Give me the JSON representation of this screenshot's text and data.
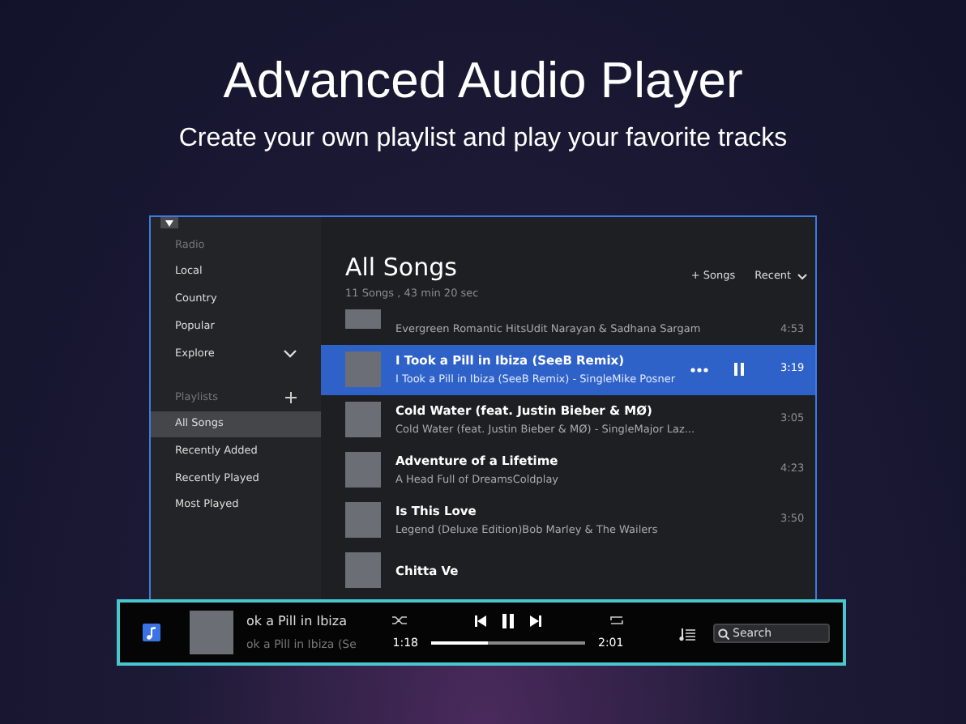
{
  "headline": "Advanced Audio Player",
  "subheadline": "Create your own playlist and play your favorite tracks",
  "sidebar": {
    "sections": [
      {
        "heading": "Radio",
        "items": [
          {
            "label": "Local",
            "selected": false
          },
          {
            "label": "Country",
            "selected": false
          },
          {
            "label": "Popular",
            "selected": false
          },
          {
            "label": "Explore",
            "selected": false,
            "expandable": true
          }
        ]
      },
      {
        "heading": "Playlists",
        "add_button": true,
        "items": [
          {
            "label": "All Songs",
            "selected": true
          },
          {
            "label": "Recently Added",
            "selected": false
          },
          {
            "label": "Recently Played",
            "selected": false
          },
          {
            "label": "Most Played",
            "selected": false
          }
        ]
      }
    ]
  },
  "content": {
    "title": "All Songs",
    "summary": "11 Songs , 43 min 20 sec",
    "add_songs": "+ Songs",
    "sort": "Recent",
    "songs": [
      {
        "subtitle": "Evergreen Romantic HitsUdit Narayan & Sadhana Sargam",
        "duration": "4:53",
        "selected": false
      },
      {
        "title": "I Took a Pill in Ibiza (SeeB Remix)",
        "subtitle": "I Took a Pill in Ibiza (SeeB Remix) - SingleMike Posner",
        "duration": "3:19",
        "selected": true
      },
      {
        "title": "Cold Water (feat. Justin Bieber & MØ)",
        "subtitle": "Cold Water (feat. Justin Bieber & MØ) - SingleMajor Laz...",
        "duration": "3:05",
        "selected": false
      },
      {
        "title": "Adventure of a Lifetime",
        "subtitle": "A Head Full of DreamsColdplay",
        "duration": "4:23",
        "selected": false
      },
      {
        "title": "Is This Love",
        "subtitle": "Legend (Deluxe Edition)Bob Marley & The Wailers",
        "duration": "3:50",
        "selected": false
      },
      {
        "title": "Chitta Ve",
        "selected": false
      }
    ]
  },
  "player": {
    "title": "ok a Pill in Ibiza",
    "subtitle": "ok a Pill in Ibiza (Se",
    "elapsed": "1:18",
    "total": "2:01",
    "level": 0.37,
    "search": {
      "placeholder": "Search"
    }
  }
}
